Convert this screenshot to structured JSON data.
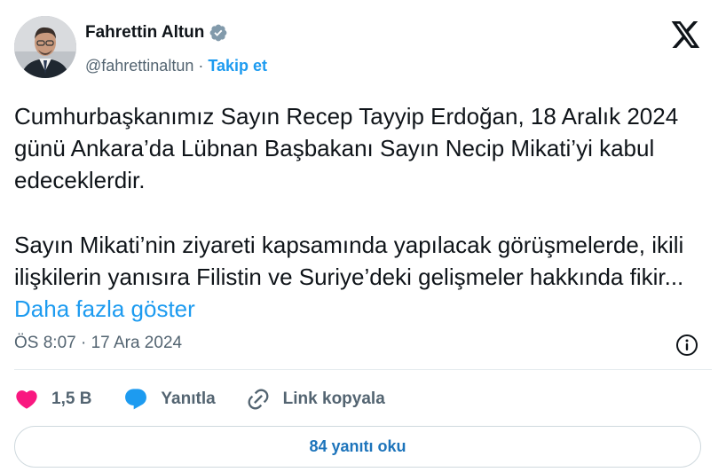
{
  "author": {
    "name": "Fahrettin Altun",
    "handle": "@fahrettinaltun",
    "separator": "·",
    "follow_label": "Takip et"
  },
  "tweet": {
    "paragraph1": "Cumhurbaşkanımız Sayın Recep Tayyip Erdoğan, 18 Aralık 2024 günü Ankara’da Lübnan Başbakanı Sayın Necip Mikati’yi kabul edeceklerdir.",
    "paragraph2": "Sayın Mikati’nin ziyareti kapsamında yapılacak görüşmelerde, ikili ilişkilerin yanısıra Filistin ve Suriye’deki gelişmeler hakkında fikir...",
    "show_more_label": "Daha fazla göster"
  },
  "meta": {
    "timestamp": "ÖS 8:07 · 17 Ara 2024"
  },
  "actions": {
    "likes_count": "1,5 B",
    "reply_label": "Yanıtla",
    "copy_link_label": "Link kopyala"
  },
  "replies_button_label": "84 yanıtı oku",
  "colors": {
    "accent": "#1d9bf0",
    "like": "#f91880",
    "text": "#0f1419",
    "secondary": "#536471"
  },
  "icons": [
    "verified-badge-icon",
    "x-logo-icon",
    "info-icon",
    "heart-icon",
    "reply-bubble-icon",
    "link-icon"
  ]
}
